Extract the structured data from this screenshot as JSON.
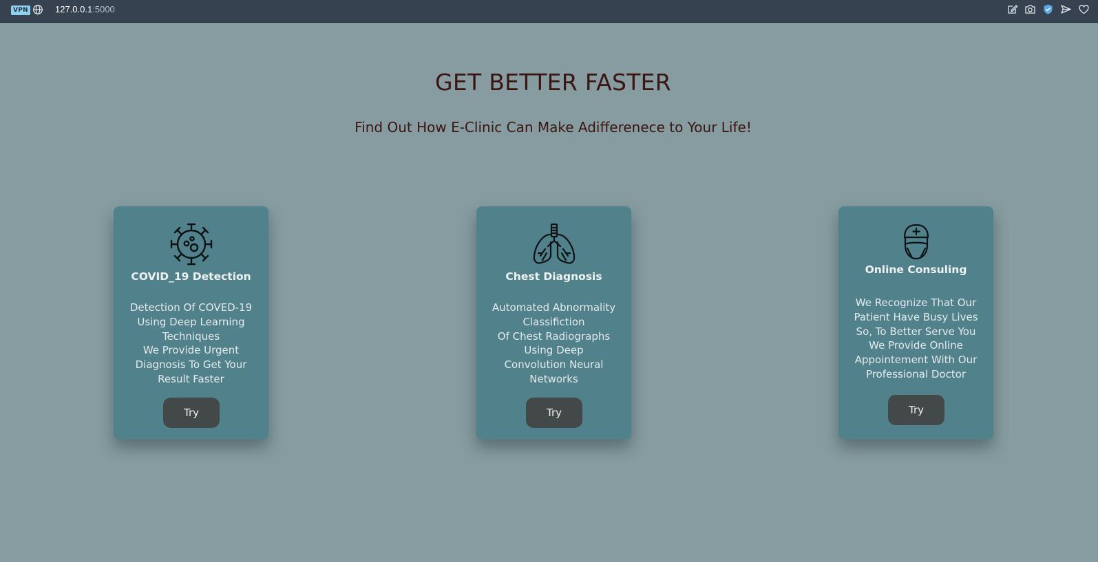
{
  "browser": {
    "vpn_label": "VPN",
    "url_host": "127.0.0.1",
    "url_port": ":5000",
    "icons": [
      "globe-icon",
      "edit-icon",
      "camera-icon",
      "shield-icon",
      "send-icon",
      "heart-icon"
    ]
  },
  "hero": {
    "title": "GET BETTER FASTER",
    "subtitle": "Find Out How E-Clinic Can Make Adifferenece to Your Life!"
  },
  "cards": [
    {
      "icon": "virus-icon",
      "title": "COVID_19 Detection",
      "lines": [
        "Detection Of COVED-19",
        "Using Deep Learning",
        "Techniques",
        "We Provide Urgent",
        "Diagnosis To Get Your",
        "Result Faster"
      ],
      "button": "Try"
    },
    {
      "icon": "lungs-icon",
      "title": "Chest Diagnosis",
      "lines": [
        "Automated Abnormality",
        "Classifiction",
        "Of Chest Radiographs",
        "Using Deep",
        "Convolution Neural",
        "Networks"
      ],
      "button": "Try"
    },
    {
      "icon": "doctor-icon",
      "title": "Online Consuling",
      "lines": [
        "We Recognize That Our",
        "Patient Have Busy Lives",
        "So, To Better Serve You",
        "We Provide Online",
        "Appointement With Our",
        "Professional Doctor"
      ],
      "button": "Try"
    }
  ],
  "colors": {
    "page_background": "#869ca0",
    "card_background": "#51818a",
    "heading_text": "#3a1512",
    "button_background": "#434848",
    "browser_bar": "#36424f"
  }
}
